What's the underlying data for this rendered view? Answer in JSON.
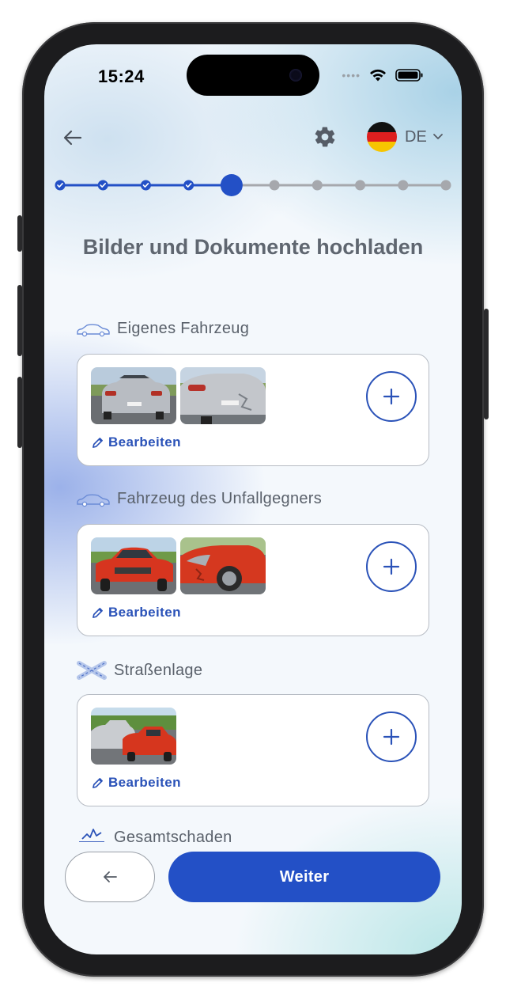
{
  "status_bar": {
    "time": "15:24",
    "signal_icon": "signal-dots-icon",
    "wifi_icon": "wifi-icon",
    "battery_icon": "battery-icon"
  },
  "header": {
    "back_icon": "arrow-left-icon",
    "settings_icon": "gear-icon",
    "flag_icon": "germany-flag-icon",
    "language": "DE",
    "language_dropdown_icon": "chevron-down-icon"
  },
  "stepper": {
    "total_steps": 10,
    "completed_steps": 4,
    "current_step": 5,
    "colors": {
      "done": "#2350c6",
      "pending": "#a6a8ad"
    }
  },
  "page": {
    "title": "Bilder und Dokumente hochladen"
  },
  "sections": [
    {
      "label": "Eigenes Fahrzeug",
      "icon": "car-outline-icon",
      "photos": [
        "silver-car-rear-photo",
        "silver-car-damage-photo"
      ],
      "edit_label": "Bearbeiten",
      "edit_icon": "pencil-icon",
      "add_icon": "plus-icon"
    },
    {
      "label": "Fahrzeug des Unfallgegners",
      "icon": "car-outline-icon",
      "photos": [
        "red-car-front-photo",
        "red-car-damage-photo"
      ],
      "edit_label": "Bearbeiten",
      "edit_icon": "pencil-icon",
      "add_icon": "plus-icon"
    },
    {
      "label": "Straßenlage",
      "icon": "road-intersection-icon",
      "photos": [
        "road-collision-photo"
      ],
      "edit_label": "Bearbeiten",
      "edit_icon": "pencil-icon",
      "add_icon": "plus-icon"
    },
    {
      "label": "Gesamtschaden",
      "icon": "total-damage-icon"
    }
  ],
  "footer": {
    "back_icon": "arrow-left-icon",
    "next_label": "Weiter"
  },
  "colors": {
    "accent": "#2350c6",
    "heading": "#5f6670",
    "text": "#5a616b"
  }
}
